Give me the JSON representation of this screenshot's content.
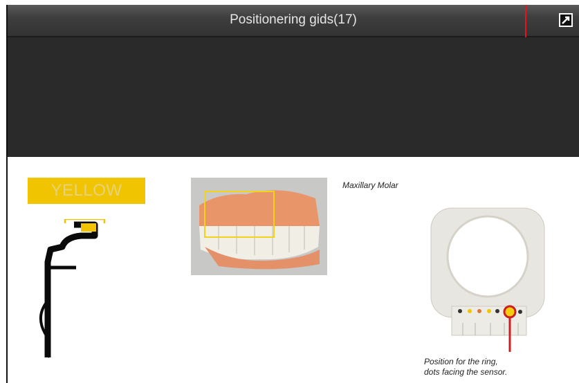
{
  "window": {
    "title": "Positionering gids(17)",
    "expand_icon": "expand-window-icon"
  },
  "content": {
    "color_label": "YELLOW",
    "teeth_caption": "Maxillary Molar",
    "ring_note_line1": "Position for the ring,",
    "ring_note_line2": "dots facing the sensor."
  },
  "colors": {
    "highlight": "#e5151f",
    "label_bg": "#f0c400",
    "titlebar": "#3e3e3e"
  }
}
